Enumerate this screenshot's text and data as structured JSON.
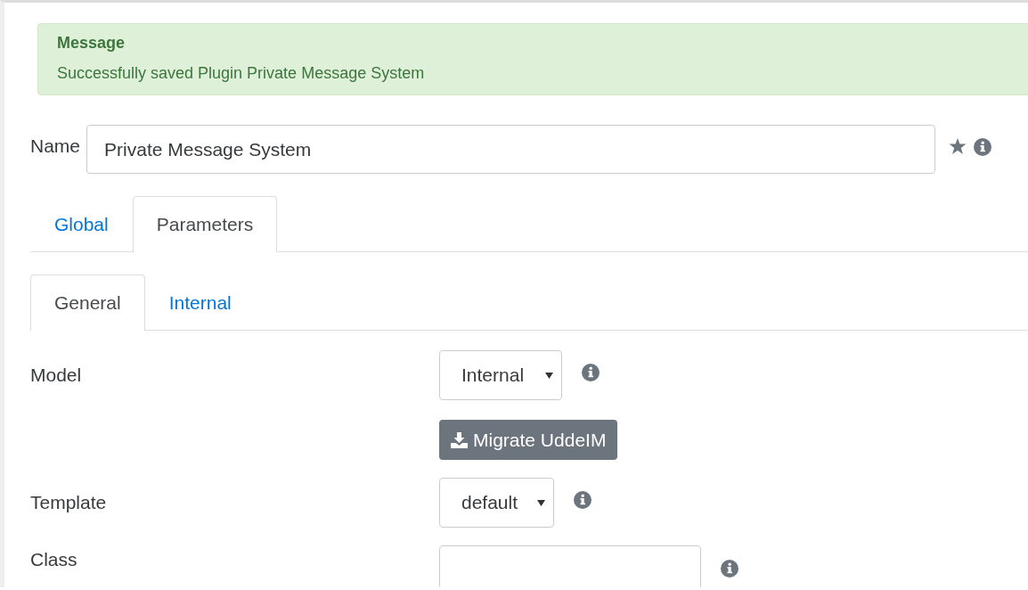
{
  "alert": {
    "title": "Message",
    "text": "Successfully saved Plugin Private Message System"
  },
  "name_field": {
    "label": "Name",
    "value": "Private Message System"
  },
  "tabs": [
    {
      "label": "Global",
      "selected": false
    },
    {
      "label": "Parameters",
      "selected": true
    }
  ],
  "subtabs": [
    {
      "label": "General",
      "selected": true
    },
    {
      "label": "Internal",
      "selected": false
    }
  ],
  "fields": [
    {
      "kind": "select",
      "label": "Model",
      "value": "Internal"
    },
    {
      "kind": "button",
      "label": "Migrate UddeIM"
    },
    {
      "kind": "select",
      "label": "Template",
      "value": "default"
    },
    {
      "kind": "input",
      "label": "Class"
    }
  ]
}
